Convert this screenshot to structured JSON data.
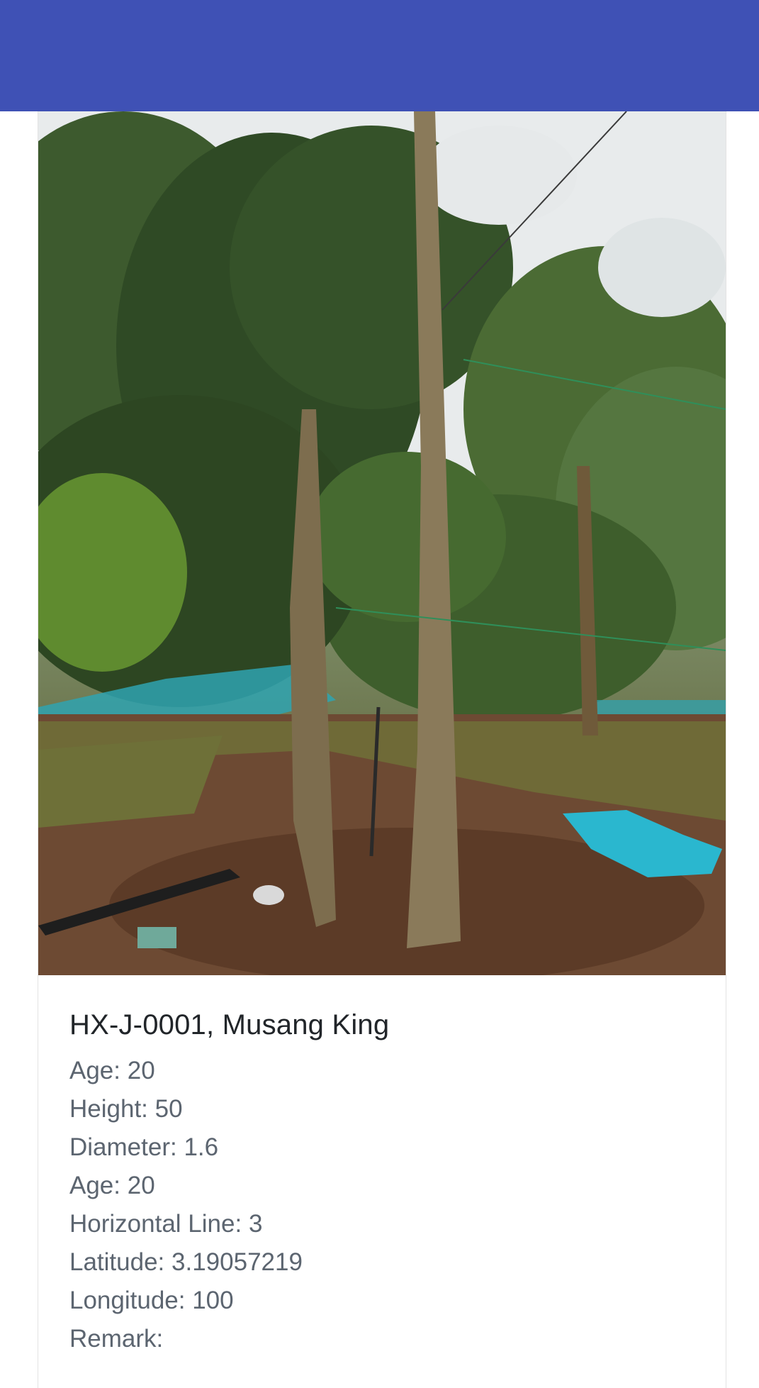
{
  "header": {
    "color": "#3f51b5"
  },
  "card": {
    "photo_alt": "tree-photo",
    "title": "HX-J-0001, Musang King",
    "fields": [
      {
        "label": "Age:",
        "value": "20"
      },
      {
        "label": "Height:",
        "value": "50"
      },
      {
        "label": "Diameter:",
        "value": "1.6"
      },
      {
        "label": "Age:",
        "value": "20"
      },
      {
        "label": "Horizontal Line:",
        "value": "3"
      },
      {
        "label": "Latitude:",
        "value": "3.19057219"
      },
      {
        "label": "Longitude:",
        "value": "100"
      },
      {
        "label": "Remark:",
        "value": ""
      }
    ]
  }
}
